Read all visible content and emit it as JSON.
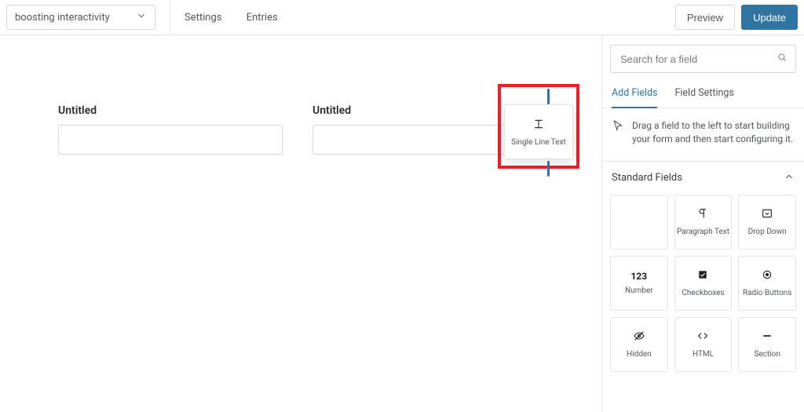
{
  "topbar": {
    "form_name": "boosting interactivity",
    "nav": {
      "settings": "Settings",
      "entries": "Entries"
    },
    "preview": "Preview",
    "update": "Update"
  },
  "canvas": {
    "fields": [
      {
        "label": "Untitled"
      },
      {
        "label": "Untitled"
      }
    ],
    "drag_tile": {
      "icon": "single-line-text-icon",
      "label": "Single Line Text"
    }
  },
  "sidebar": {
    "search_placeholder": "Search for a field",
    "tabs": {
      "add": "Add Fields",
      "settings": "Field Settings",
      "active": "add"
    },
    "hint": "Drag a field to the left to start building your form and then start configuring it.",
    "accordion_title": "Standard Fields",
    "tiles": [
      {
        "icon": "",
        "label": ""
      },
      {
        "icon": "paragraph-icon",
        "label": "Paragraph Text"
      },
      {
        "icon": "dropdown-icon",
        "label": "Drop Down"
      },
      {
        "icon": "number-icon",
        "label": "Number"
      },
      {
        "icon": "checkboxes-icon",
        "label": "Checkboxes"
      },
      {
        "icon": "radio-icon",
        "label": "Radio Buttons"
      },
      {
        "icon": "hidden-icon",
        "label": "Hidden"
      },
      {
        "icon": "html-icon",
        "label": "HTML"
      },
      {
        "icon": "section-icon",
        "label": "Section"
      }
    ]
  }
}
